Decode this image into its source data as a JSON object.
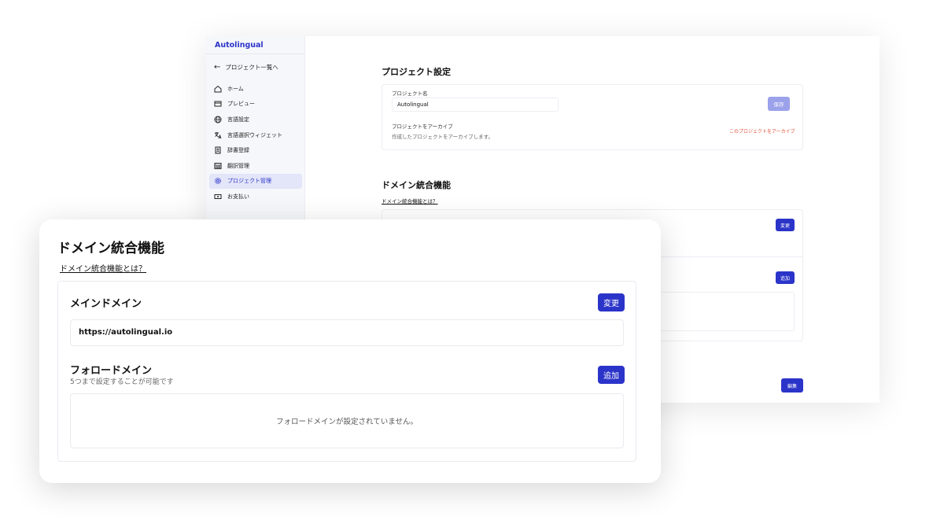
{
  "app": {
    "name": "Autolingual"
  },
  "sidebar": {
    "back_label": "プロジェクト一覧へ",
    "items": [
      {
        "label": "ホーム",
        "icon": "home-icon"
      },
      {
        "label": "プレビュー",
        "icon": "preview-icon"
      },
      {
        "label": "言語設定",
        "icon": "globe-icon"
      },
      {
        "label": "言語選択ウィジェット",
        "icon": "translate-icon"
      },
      {
        "label": "辞書登録",
        "icon": "dictionary-icon"
      },
      {
        "label": "翻訳管理",
        "icon": "table-icon"
      },
      {
        "label": "プロジェクト管理",
        "icon": "gear-icon",
        "active": true
      },
      {
        "label": "お支払い",
        "icon": "payment-icon"
      }
    ]
  },
  "project_settings": {
    "title": "プロジェクト設定",
    "name_label": "プロジェクト名",
    "name_value": "Autolingual",
    "save_label": "保存",
    "archive_title": "プロジェクトをアーカイブ",
    "archive_desc": "作成したプロジェクトをアーカイブします。",
    "archive_link": "このプロジェクトをアーカイブ"
  },
  "domain_back": {
    "title": "ドメイン統合機能",
    "help_link": "ドメイン統合機能とは？",
    "change_label": "変更",
    "add_label": "追加",
    "edit_label": "編集"
  },
  "domain": {
    "title": "ドメイン統合機能",
    "help_link": "ドメイン統合機能とは？",
    "main_domain_title": "メインドメイン",
    "change_label": "変更",
    "main_domain_value": "https://autolingual.io",
    "follow_domain_title": "フォロードメイン",
    "follow_domain_subtext": "5つまで設定することが可能です",
    "add_label": "追加",
    "empty_message": "フォロードメインが設定されていません。"
  },
  "colors": {
    "accent": "#2b34c9",
    "danger": "#e0533d",
    "save_disabled": "#9ba1ea"
  }
}
